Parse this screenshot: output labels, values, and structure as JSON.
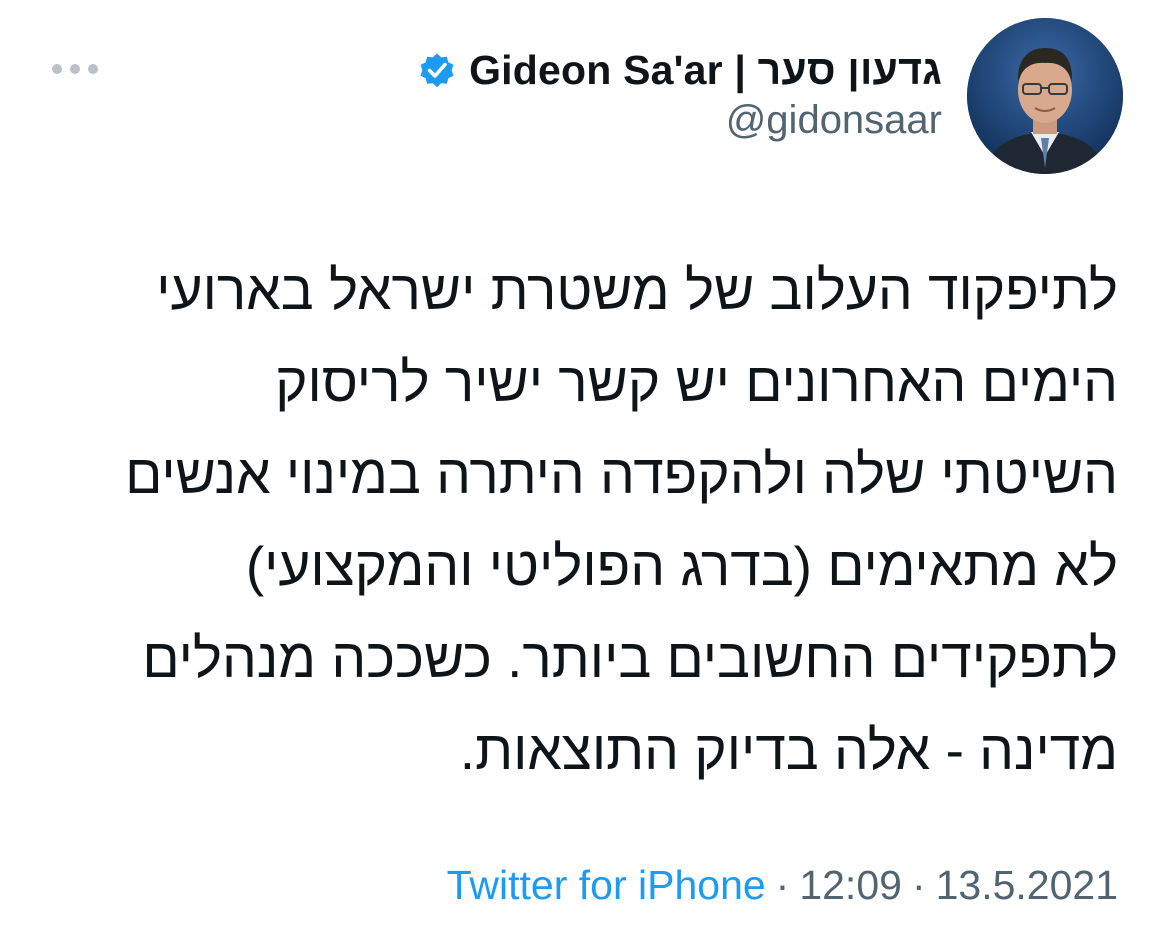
{
  "tweet": {
    "display_name": "Gideon Sa'ar | גדעון סער",
    "handle": "@gidonsaar",
    "verified": true,
    "body_lines": [
      "לתיפקוד העלוב של משטרת ישראל בארועי",
      "הימים האחרונים יש קשר ישיר לריסוק",
      "השיטתי שלה ולהקפדה היתרה במינוי אנשים",
      "לא מתאימים (בדרג הפוליטי והמקצועי)",
      "לתפקידים החשובים ביותר. כשככה מנהלים",
      "מדינה - אלה בדיוק התוצאות."
    ],
    "source": "Twitter for iPhone",
    "separator": "·",
    "time": "12:09",
    "date": "13.5.2021"
  },
  "icons": {
    "more": "more-horizontal-icon",
    "verified": "verified-badge-icon",
    "avatar": "profile-avatar"
  },
  "colors": {
    "link": "#1d9bf0",
    "verified": "#1d9bf0",
    "secondary_text": "#536471",
    "primary_text": "#0f1419",
    "more_dots": "#b9c1c9"
  }
}
